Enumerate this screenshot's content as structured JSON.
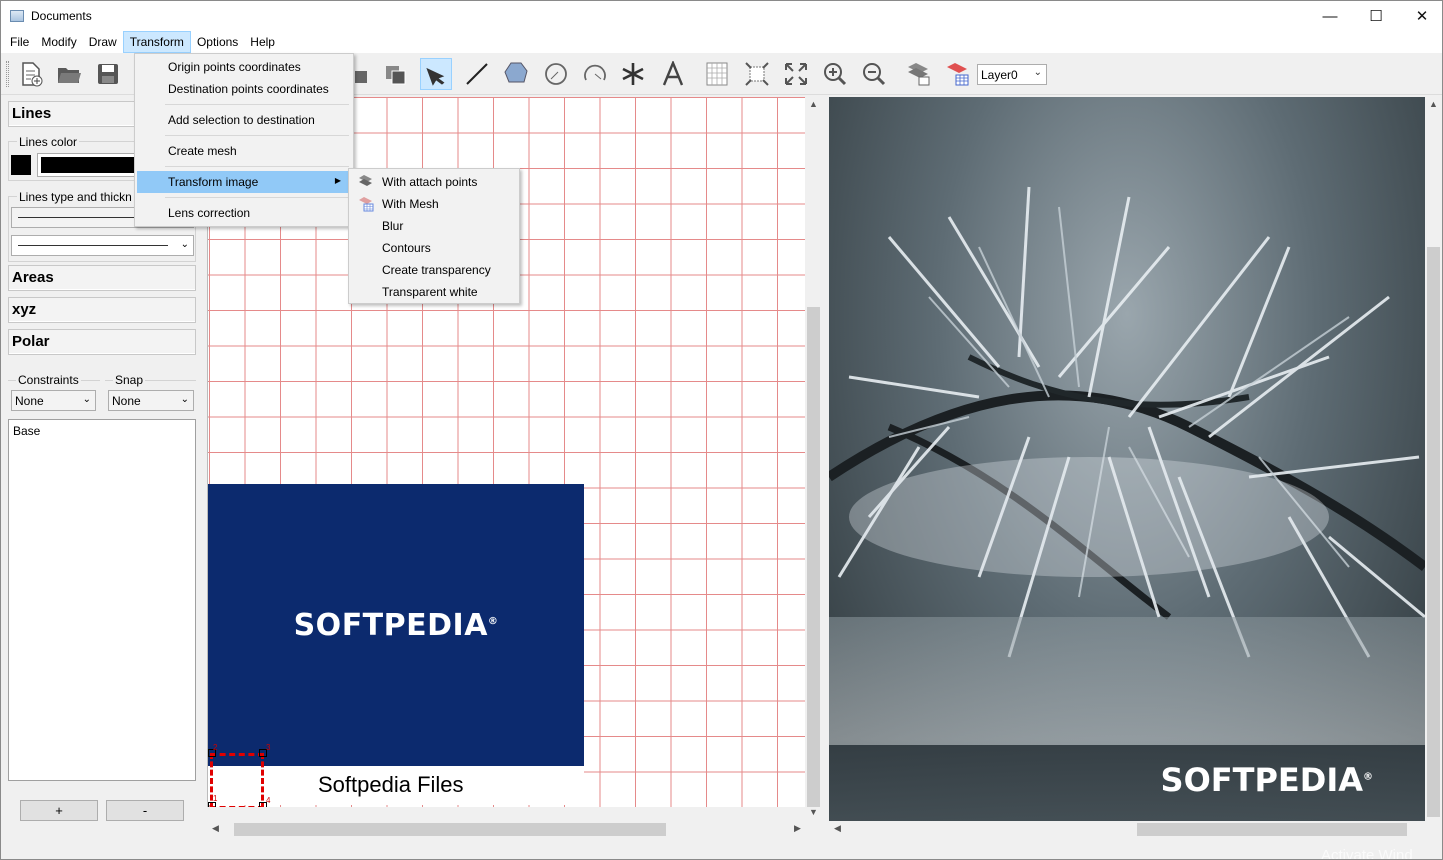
{
  "window": {
    "title": "Documents"
  },
  "menubar": [
    "File",
    "Modify",
    "Draw",
    "Transform",
    "Options",
    "Help"
  ],
  "toolbar": {
    "layer": "Layer0"
  },
  "left_panel": {
    "lines_header": "Lines",
    "lines_color_label": "Lines color",
    "lines_type_label": "Lines type and thickn",
    "areas_header": "Areas",
    "xyz_header": "xyz",
    "polar_header": "Polar",
    "constraints_label": "Constraints",
    "constraints_value": "None",
    "snap_label": "Snap",
    "snap_value": "None",
    "layers_list": [
      "Base"
    ],
    "add_button": "+",
    "remove_button": "-"
  },
  "canvas": {
    "logo_text": "SOFTPEDIA",
    "logo_mark": "®",
    "caption": "Softpedia Files",
    "handles": [
      "1",
      "2",
      "3",
      "4"
    ]
  },
  "photo": {
    "logo_text": "SOFTPEDIA",
    "logo_mark": "®"
  },
  "transform_menu": {
    "items": [
      "Origin points coordinates",
      "Destination points coordinates",
      "Add selection to destination",
      "Create mesh",
      "Transform image",
      "Lens correction"
    ],
    "highlighted": "Transform image"
  },
  "transform_image_submenu": {
    "items": [
      "With attach points",
      "With Mesh",
      "Blur",
      "Contours",
      "Create transparency",
      "Transparent white"
    ]
  },
  "watermark": "Activate Wind"
}
